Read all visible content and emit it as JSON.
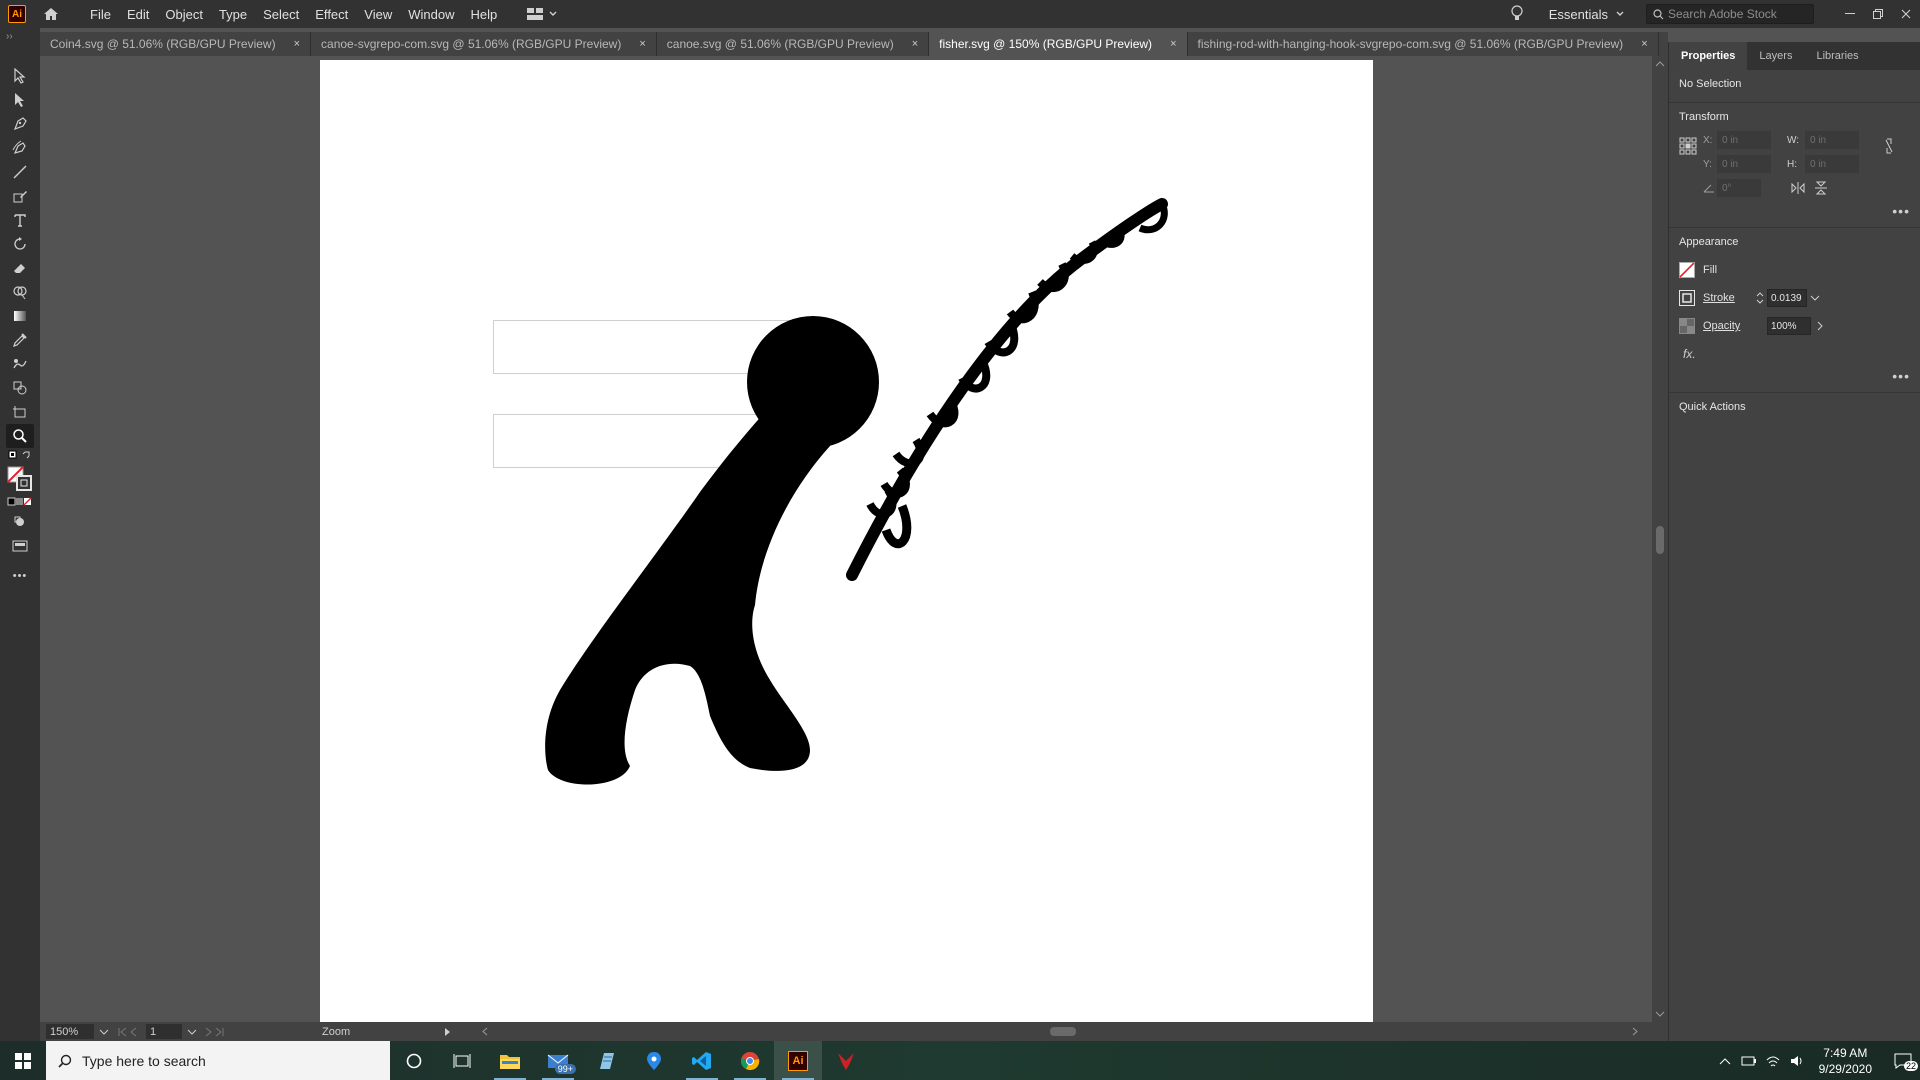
{
  "app": {
    "logo": "Ai",
    "menu": [
      "File",
      "Edit",
      "Object",
      "Type",
      "Select",
      "Effect",
      "View",
      "Window",
      "Help"
    ],
    "workspace": "Essentials",
    "stock_search_placeholder": "Search Adobe Stock"
  },
  "tabs": [
    {
      "label": "Coin4.svg @ 51.06% (RGB/GPU Preview)",
      "active": false
    },
    {
      "label": "canoe-svgrepo-com.svg @ 51.06% (RGB/GPU Preview)",
      "active": false
    },
    {
      "label": "canoe.svg @ 51.06% (RGB/GPU Preview)",
      "active": false
    },
    {
      "label": "fisher.svg @ 150% (RGB/GPU Preview)",
      "active": true
    },
    {
      "label": "fishing-rod-with-hanging-hook-svgrepo-com.svg @ 51.06% (RGB/GPU Preview)",
      "active": false
    }
  ],
  "tab_close": "×",
  "toolbar": {
    "collapse": "››",
    "tools": [
      "selection-tool",
      "direct-selection-tool",
      "pen-tool",
      "curvature-tool",
      "line-tool",
      "pencil-tool",
      "type-tool",
      "rotate-tool",
      "eraser-tool",
      "shape-builder-tool",
      "gradient-tool",
      "eyedropper-tool",
      "puppet-warp-tool",
      "blend-tool",
      "artboard-tool",
      "zoom-tool"
    ],
    "active_tool": "zoom-tool",
    "more": "•••"
  },
  "status": {
    "zoom": "150%",
    "page": "1",
    "tool_name": "Zoom"
  },
  "panel": {
    "tabs": [
      "Properties",
      "Layers",
      "Libraries"
    ],
    "selection": "No Selection",
    "transform": {
      "title": "Transform",
      "x_label": "X:",
      "x_value": "0 in",
      "y_label": "Y:",
      "y_value": "0 in",
      "w_label": "W:",
      "w_value": "0 in",
      "h_label": "H:",
      "h_value": "0 in",
      "angle_value": "0°"
    },
    "appearance": {
      "title": "Appearance",
      "fill_label": "Fill",
      "stroke_label": "Stroke",
      "stroke_value": "0.0139",
      "opacity_label": "Opacity",
      "opacity_value": "100%",
      "fx_label": "fx."
    },
    "quick_actions": "Quick Actions",
    "more": "•••"
  },
  "taskbar": {
    "search_placeholder": "Type here to search",
    "mail_badge": "99+",
    "time": "7:49 AM",
    "date": "9/29/2020",
    "notifications": "22"
  }
}
